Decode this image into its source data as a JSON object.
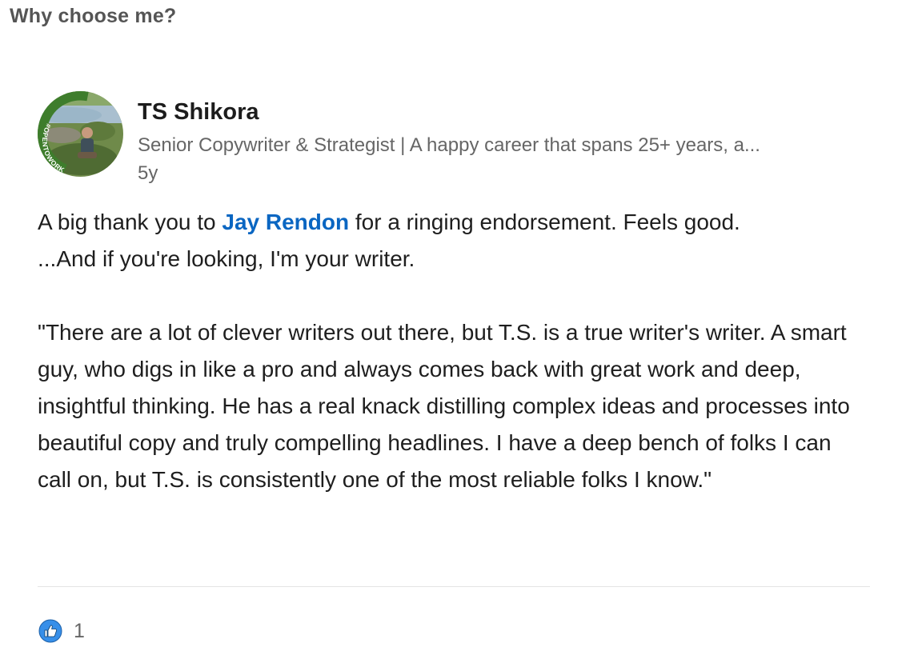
{
  "section": {
    "title": "Why choose me?"
  },
  "post": {
    "author": {
      "name": "TS Shikora",
      "headline": "Senior Copywriter & Strategist | A happy career that spans 25+ years, a...",
      "badge_text": "#OPENTOWORK"
    },
    "time": "5y",
    "body": {
      "line1_before": "A big thank you to ",
      "mention": "Jay Rendon",
      "line1_after": " for a ringing endorsement. Feels good.",
      "line2": "...And if you're looking, I'm your writer.",
      "quote": "\"There are a lot of clever writers out there, but T.S. is a true writer's writer. A smart guy, who digs in like a pro and always comes back with great work and deep, insightful thinking. He has a real knack distilling complex ideas and processes into beautiful copy and truly compelling headlines. I have a deep bench of folks I can call on, but T.S. is consistently one of the most reliable folks I know.\""
    },
    "reactions": {
      "icon": "like-icon",
      "count": "1"
    }
  },
  "colors": {
    "mention": "#0a66c2",
    "like": "#378fe9",
    "badge": "#3e7d2c"
  }
}
